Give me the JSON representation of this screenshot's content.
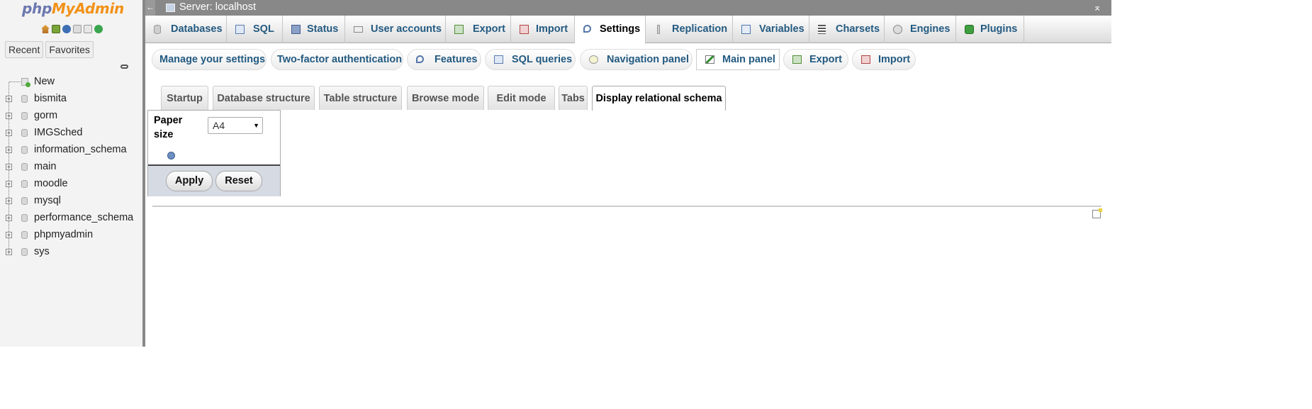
{
  "logo": {
    "php": "php",
    "my": "My",
    "admin": "Admin"
  },
  "nav": {
    "quick_icons": [
      "home-icon",
      "exit-icon",
      "help-icon",
      "docs-icon",
      "docs2-icon",
      "reload-icon"
    ],
    "tabs": {
      "recent": "Recent",
      "favorites": "Favorites"
    },
    "tree_new": "New",
    "databases": [
      "bismita",
      "gorm",
      "IMGSched",
      "information_schema",
      "main",
      "moodle",
      "mysql",
      "performance_schema",
      "phpmyadmin",
      "sys"
    ]
  },
  "topbar": {
    "back": "←",
    "server": "Server: localhost",
    "collapse": "⌅"
  },
  "mainmenu": {
    "tabs": [
      "Databases",
      "SQL",
      "Status",
      "User accounts",
      "Export",
      "Import",
      "Settings",
      "Replication",
      "Variables",
      "Charsets",
      "Engines",
      "Plugins"
    ]
  },
  "subtabs": [
    "Manage your settings",
    "Two-factor authentication",
    "Features",
    "SQL queries",
    "Navigation panel",
    "Main panel",
    "Export",
    "Import"
  ],
  "sectiontabs": [
    "Startup",
    "Database structure",
    "Table structure",
    "Browse mode",
    "Edit mode",
    "Tabs",
    "Display relational schema"
  ],
  "form": {
    "paper_size_label": "Paper size",
    "paper_size_value": "A4",
    "arrow": "▼",
    "apply": "Apply",
    "reset": "Reset"
  },
  "colors": {
    "link": "#235a81",
    "topbar": "#888888",
    "nav_bg": "#f3f3f3"
  }
}
